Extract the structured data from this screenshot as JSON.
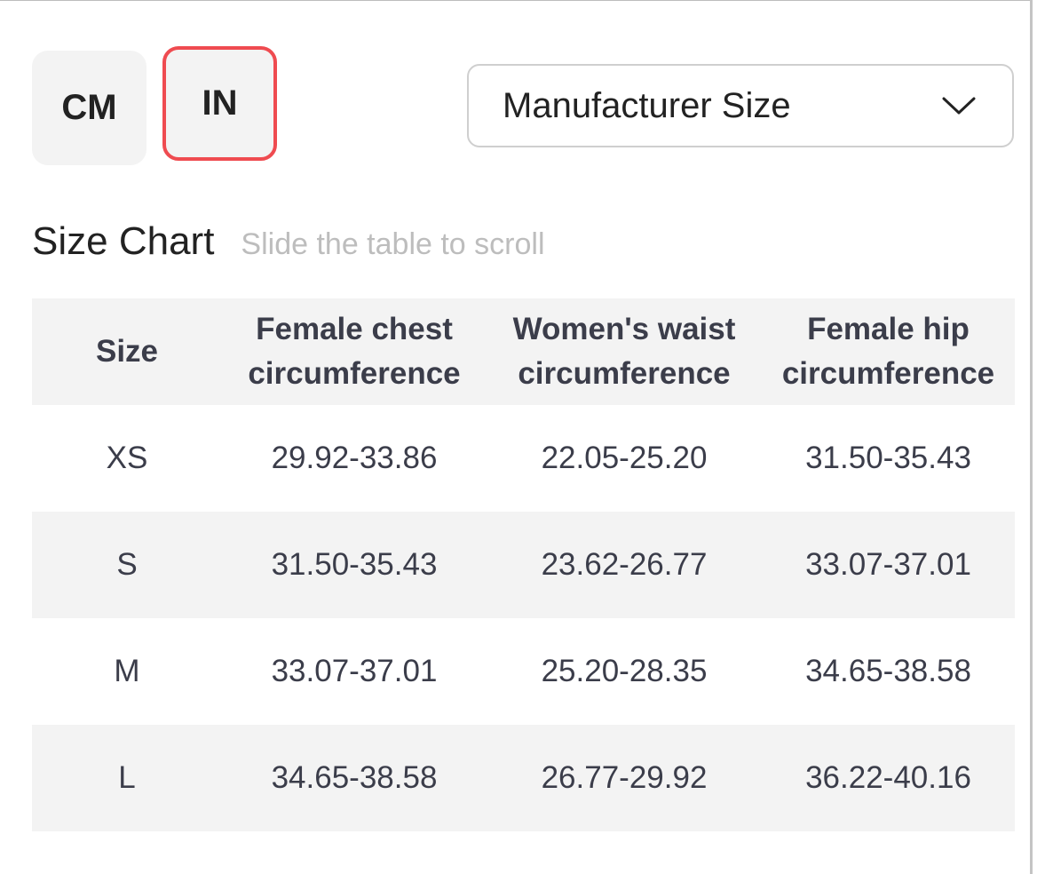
{
  "unit_toggle": {
    "options": [
      {
        "label": "CM",
        "selected": false
      },
      {
        "label": "IN",
        "selected": true
      }
    ],
    "selected_color": "#ef4b50"
  },
  "size_select": {
    "value": "Manufacturer Size",
    "icon": "chevron-down-icon"
  },
  "chart": {
    "title": "Size Chart",
    "hint": "Slide the table to scroll"
  },
  "table": {
    "headers": [
      [
        "Size"
      ],
      [
        "Female chest",
        "circumference"
      ],
      [
        "Women's waist",
        "circumference"
      ],
      [
        "Female hip",
        "circumference"
      ]
    ],
    "rows": [
      [
        "XS",
        "29.92-33.86",
        "22.05-25.20",
        "31.50-35.43"
      ],
      [
        "S",
        "31.50-35.43",
        "23.62-26.77",
        "33.07-37.01"
      ],
      [
        "M",
        "33.07-37.01",
        "25.20-28.35",
        "34.65-38.58"
      ],
      [
        "L",
        "34.65-38.58",
        "26.77-29.92",
        "36.22-40.16"
      ]
    ]
  }
}
